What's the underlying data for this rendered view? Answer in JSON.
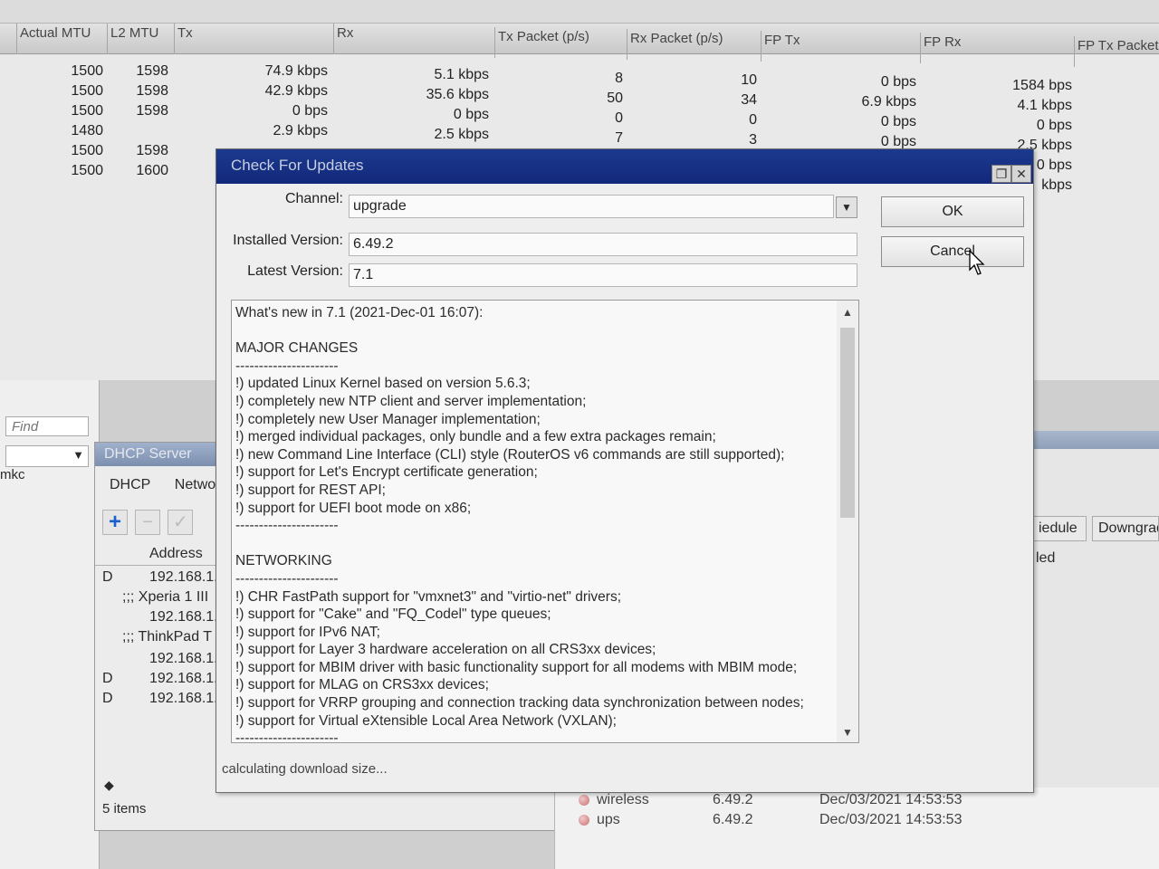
{
  "bg_table": {
    "columns": [
      "Actual MTU",
      "L2 MTU",
      "Tx",
      "Rx",
      "Tx Packet (p/s)",
      "Rx Packet (p/s)",
      "FP Tx",
      "FP Rx",
      "FP Tx Packet"
    ],
    "rows": [
      {
        "mtu": "1500",
        "l2mtu": "1598",
        "tx": "74.9 kbps",
        "rx": "5.1 kbps",
        "txp": "8",
        "rxp": "10",
        "fptx": "0 bps",
        "fprx": "1584 bps"
      },
      {
        "mtu": "1500",
        "l2mtu": "1598",
        "tx": "42.9 kbps",
        "rx": "35.6 kbps",
        "txp": "50",
        "rxp": "34",
        "fptx": "6.9 kbps",
        "fprx": "4.1 kbps"
      },
      {
        "mtu": "1500",
        "l2mtu": "1598",
        "tx": "0 bps",
        "rx": "0 bps",
        "txp": "0",
        "rxp": "0",
        "fptx": "0 bps",
        "fprx": "0 bps"
      },
      {
        "mtu": "1480",
        "l2mtu": "",
        "tx": "2.9 kbps",
        "rx": "2.5 kbps",
        "txp": "7",
        "rxp": "3",
        "fptx": "0 bps",
        "fprx": "2.5 kbps"
      },
      {
        "mtu": "1500",
        "l2mtu": "1598",
        "tx": "",
        "rx": "",
        "txp": "",
        "rxp": "",
        "fptx": "",
        "fprx": "0 bps"
      },
      {
        "mtu": "1500",
        "l2mtu": "1600",
        "tx": "",
        "rx": "",
        "txp": "",
        "rxp": "",
        "fptx": "",
        "fprx": "kbps"
      }
    ]
  },
  "left_panel": {
    "find_placeholder": "Find",
    "label": "mkc"
  },
  "dhcp_window": {
    "title": "DHCP Server",
    "tabs": [
      "DHCP",
      "Networ"
    ],
    "column_address": "Address",
    "rows": [
      {
        "flag": "D",
        "value": "192.168.1."
      },
      {
        "flag": "",
        "value": ";;; Xperia 1 III"
      },
      {
        "flag": "",
        "value": "192.168.1."
      },
      {
        "flag": "",
        "value": ";;; ThinkPad T"
      },
      {
        "flag": "",
        "value": "192.168.1."
      },
      {
        "flag": "D",
        "value": "192.168.1."
      },
      {
        "flag": "D",
        "value": "192.168.1."
      }
    ],
    "count": "5 items"
  },
  "right_panel": {
    "schedule_label": "iedule",
    "downgrade_label": "Downgrad",
    "led_label": "led"
  },
  "packages": [
    {
      "name": "wireless",
      "version": "6.49.2",
      "date": "Dec/03/2021 14:53:53"
    },
    {
      "name": "ups",
      "version": "6.49.2",
      "date": "Dec/03/2021 14:53:53"
    }
  ],
  "dialog": {
    "title": "Check For Updates",
    "channel_label": "Channel:",
    "channel_value": "upgrade",
    "installed_label": "Installed Version:",
    "installed_value": "6.49.2",
    "latest_label": "Latest Version:",
    "latest_value": "7.1",
    "ok_label": "OK",
    "cancel_label": "Cancel",
    "whats_new": "What's new in 7.1 (2021-Dec-01 16:07):\n\nMAJOR CHANGES\n----------------------\n!) updated Linux Kernel based on version 5.6.3;\n!) completely new NTP client and server implementation;\n!) completely new User Manager implementation;\n!) merged individual packages, only bundle and a few extra packages remain;\n!) new Command Line Interface (CLI) style (RouterOS v6 commands are still supported);\n!) support for Let's Encrypt certificate generation;\n!) support for REST API;\n!) support for UEFI boot mode on x86;\n----------------------\n\nNETWORKING\n----------------------\n!) CHR FastPath support for \"vmxnet3\" and \"virtio-net\" drivers;\n!) support for \"Cake\" and \"FQ_Codel\" type queues;\n!) support for IPv6 NAT;\n!) support for Layer 3 hardware acceleration on all CRS3xx devices;\n!) support for MBIM driver with basic functionality support for all modems with MBIM mode;\n!) support for MLAG on CRS3xx devices;\n!) support for VRRP grouping and connection tracking data synchronization between nodes;\n!) support for Virtual eXtensible Local Area Network (VXLAN);\n----------------------",
    "status": "calculating download size..."
  },
  "colors": {
    "titlebar": "#1b3a8e",
    "title_text": "#c8cfe2",
    "add_icon": "#1c5fd0"
  }
}
